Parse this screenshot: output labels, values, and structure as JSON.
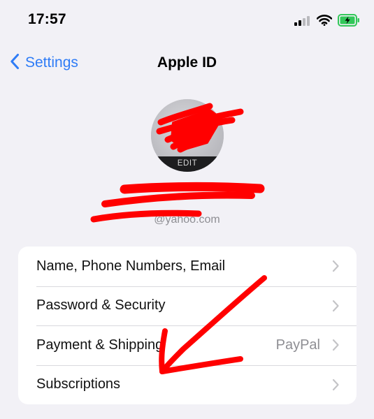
{
  "status_bar": {
    "time": "17:57",
    "signal_icon": "cellular-signal-icon",
    "wifi_icon": "wifi-icon",
    "battery_icon": "battery-charging-icon"
  },
  "nav": {
    "back_label": "Settings",
    "title": "Apple ID"
  },
  "profile": {
    "avatar_edit_label": "EDIT",
    "name": "",
    "email": "@yahoo.com"
  },
  "menu": {
    "items": [
      {
        "label": "Name, Phone Numbers, Email",
        "value": ""
      },
      {
        "label": "Password & Security",
        "value": ""
      },
      {
        "label": "Payment & Shipping",
        "value": "PayPal"
      },
      {
        "label": "Subscriptions",
        "value": ""
      }
    ]
  },
  "colors": {
    "background": "#f2f1f6",
    "card": "#ffffff",
    "accent": "#2f7cf6",
    "secondary_text": "#8e8e93",
    "markup_red": "#ff0000",
    "battery_green": "#32c759"
  }
}
